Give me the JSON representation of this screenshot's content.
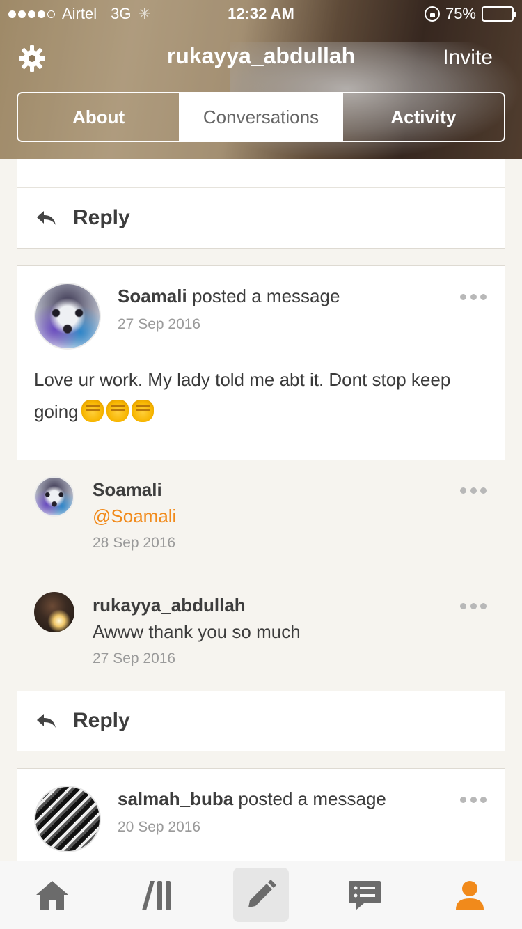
{
  "status_bar": {
    "carrier": "Airtel",
    "network": "3G",
    "time": "12:32 AM",
    "battery": "75%",
    "battery_level": 0.75
  },
  "header": {
    "title": "rukayya_abdullah",
    "invite_label": "Invite",
    "tabs": [
      {
        "label": "About",
        "active": false
      },
      {
        "label": "Conversations",
        "active": true
      },
      {
        "label": "Activity",
        "active": false
      }
    ]
  },
  "feed": {
    "top_reply_label": "Reply",
    "posts": [
      {
        "author": "Soamali",
        "action": " posted a message",
        "date": "27 Sep 2016",
        "message": "Love ur work. My lady told me abt it. Dont stop keep going",
        "comments": [
          {
            "name": "Soamali",
            "text": "@Soamali",
            "date": "28 Sep 2016"
          },
          {
            "name": "rukayya_abdullah",
            "text": "Awww thank you so much",
            "date": "27 Sep 2016"
          }
        ],
        "reply_label": "Reply"
      },
      {
        "author": "salmah_buba",
        "action": " posted a message",
        "date": "20 Sep 2016"
      }
    ]
  },
  "colors": {
    "accent": "#f18a1b",
    "icon_gray": "#6b6b6b",
    "battery_yellow": "#f6c21b"
  },
  "bottom_nav": [
    {
      "icon": "home-icon"
    },
    {
      "icon": "channels-icon"
    },
    {
      "icon": "compose-icon"
    },
    {
      "icon": "messages-icon"
    },
    {
      "icon": "profile-icon",
      "active": true
    }
  ]
}
